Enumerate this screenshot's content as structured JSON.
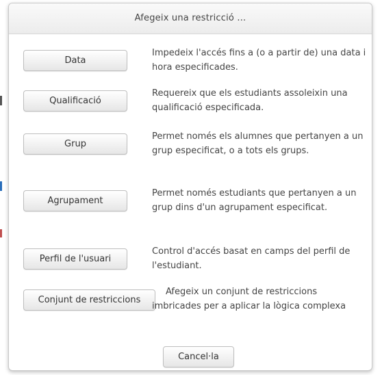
{
  "dialog": {
    "title": "Afegeix una restricció ...",
    "options": [
      {
        "button_label": "Data",
        "description": "Impedeix l'accés fins a (o a partir de) una data i hora especificades."
      },
      {
        "button_label": "Qualificació",
        "description": "Requereix que els estudiants assoleixin una qualificació especificada."
      },
      {
        "button_label": "Grup",
        "description": "Permet només els alumnes que pertanyen a un grup especificat, o a tots els grups."
      },
      {
        "button_label": "Agrupament",
        "description": "Permet només estudiants que pertanyen a un grup dins d'un agrupament especificat."
      },
      {
        "button_label": "Perfil de l'usuari",
        "description": "Control d'accés basat en camps del perfil de l'estudiant."
      },
      {
        "button_label": "Conjunt de restriccions",
        "description": "Afegeix un conjunt de restriccions imbricades per a aplicar la lògica complexa"
      }
    ],
    "cancel_label": "Cancel·la"
  }
}
